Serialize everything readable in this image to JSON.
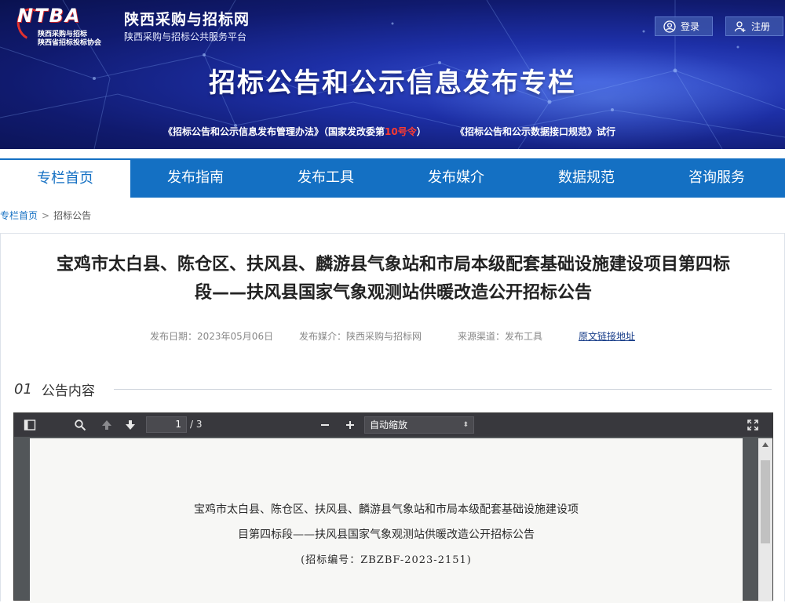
{
  "header": {
    "logo_mark": "NTBA",
    "logo_sub1": "陕西采购与招标",
    "logo_sub2": "陕西省招标投标协会",
    "site_name": "陕西采购与招标网",
    "site_subtitle": "陕西采购与招标公共服务平台",
    "login_label": "登录",
    "register_label": "注册",
    "banner_title": "招标公告和公示信息发布专栏",
    "notice1_prefix": "《招标公告和公示信息发布管理办法》（国家发改委第",
    "notice1_highlight": "10号令",
    "notice1_suffix": "）",
    "notice2": "《招标公告和公示数据接口规范》试行"
  },
  "nav": {
    "items": [
      {
        "label": "专栏首页"
      },
      {
        "label": "发布指南"
      },
      {
        "label": "发布工具"
      },
      {
        "label": "发布媒介"
      },
      {
        "label": "数据规范"
      },
      {
        "label": "咨询服务"
      }
    ]
  },
  "breadcrumb": {
    "home": "专栏首页",
    "separator": ">",
    "current": "招标公告"
  },
  "article": {
    "title_line1": "宝鸡市太白县、陈仓区、扶风县、麟游县气象站和市局本级配套基础设施建设项目第四标",
    "title_line2": "段——扶风县国家气象观测站供暖改造公开招标公告",
    "publish_date": "发布日期：2023年05月06日",
    "publish_media": "发布媒介：陕西采购与招标网",
    "source_channel": "来源渠道：发布工具",
    "original_link": "原文链接地址",
    "section_num": "01",
    "section_label": "公告内容"
  },
  "viewer": {
    "page_current": "1",
    "page_total": "/ 3",
    "zoom_label": "自动缩放",
    "zoom_arrow": "⬍",
    "doc_line1": "宝鸡市太白县、陈仓区、扶风县、麟游县气象站和市局本级配套基础设施建设项",
    "doc_line2": "目第四标段——扶风县国家气象观测站供暖改造公开招标公告",
    "doc_line3": "(招标编号：ZBZBF-2023-2151)"
  },
  "colors": {
    "primary": "#1470c3",
    "banner_dark": "#0a1250",
    "highlight_red": "#ff3b30",
    "toolbar": "#38383d"
  }
}
